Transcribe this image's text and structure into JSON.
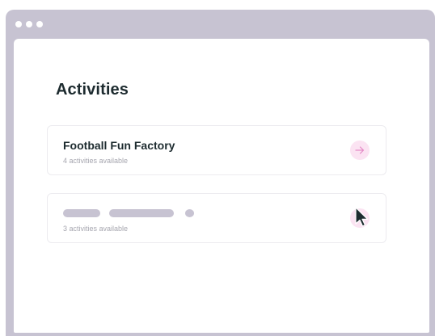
{
  "page": {
    "title": "Activities"
  },
  "cards": [
    {
      "title": "Football Fun Factory",
      "subtitle": "4 activities available",
      "action_icon": "arrow-right-icon"
    },
    {
      "title_loading": true,
      "subtitle": "3 activities available",
      "action_icon": "arrow-right-icon"
    }
  ],
  "colors": {
    "window_frame": "#c7c3d2",
    "heading_text": "#1d2b2f",
    "muted_text": "#a7a7b0",
    "card_border": "#ecebef",
    "accent_bg": "#fbe3f2",
    "accent_arrow": "#e58bc7",
    "skeleton": "#c7c3d2"
  },
  "icons": {
    "window_controls": [
      "dot-icon",
      "dot-icon",
      "dot-icon"
    ],
    "pointer": "cursor-arrow-icon"
  }
}
